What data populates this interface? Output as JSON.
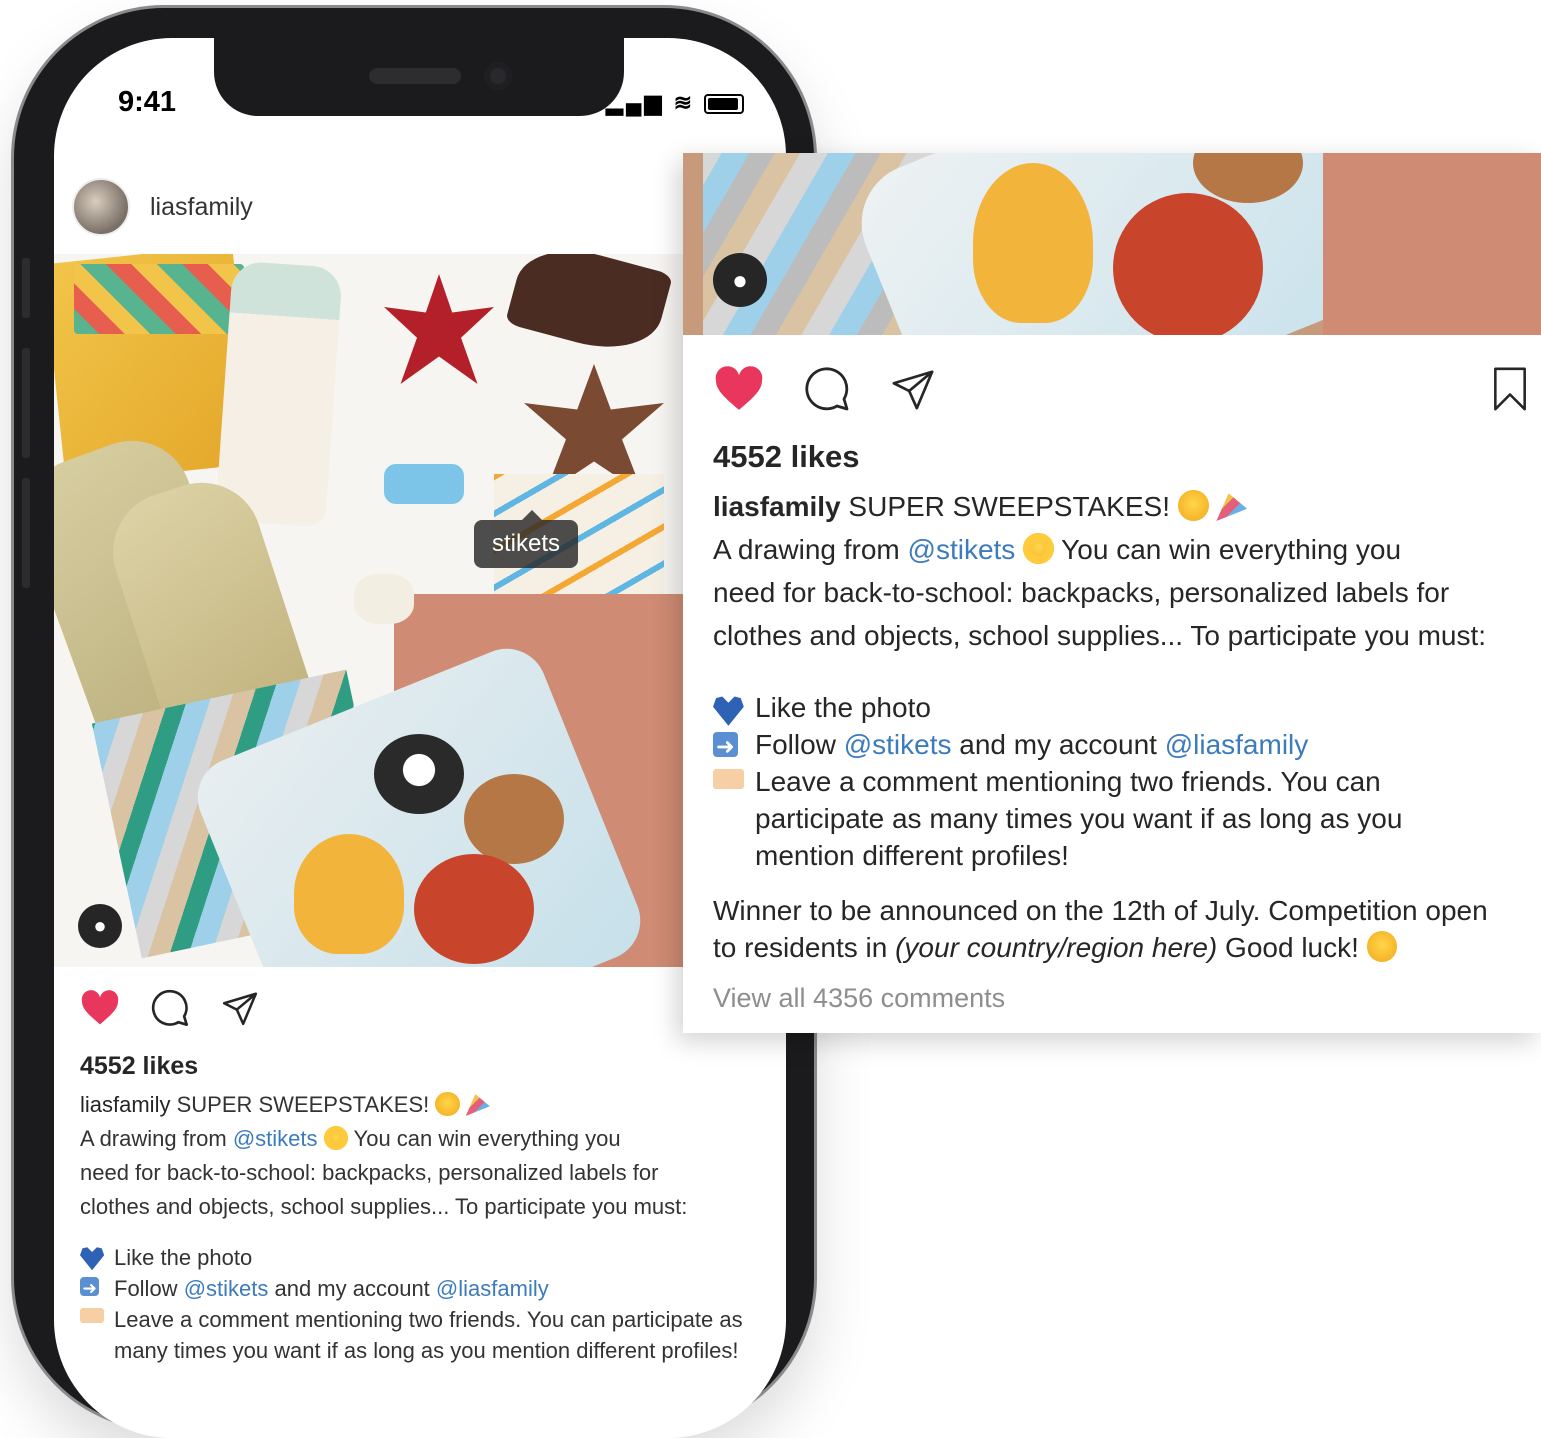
{
  "status_bar": {
    "time": "9:41"
  },
  "post": {
    "username": "liasfamily",
    "photo_tag": "stikets",
    "likes": "4552 likes",
    "caption": {
      "username": "liasfamily",
      "headline": "SUPER SWEEPSTAKES!",
      "intro_pre": "A drawing from ",
      "intro_mention": "@stikets",
      "line1_post": " You can win everything you",
      "line2": "need for back-to-school: backpacks, personalized labels for",
      "line3": "clothes and objects, school supplies... To participate you must:",
      "bullet_like": "Like the photo",
      "bullet_follow_pre": "Follow ",
      "bullet_follow_mention1": "@stikets",
      "bullet_follow_mid": " and my account ",
      "bullet_follow_mention2": "@liasfamily",
      "bullet_comment": "Leave a comment mentioning two friends. You can participate as many times you want if as long as you mention different profiles!",
      "winner_pre": "Winner to be announced on the 12th of July. Competition open to residents in ",
      "winner_region": "(your country/region here)",
      "winner_post": " Good luck!"
    },
    "view_all": "View all 4356 comments"
  },
  "icons": {
    "like": "heart-filled-icon",
    "comment": "comment-bubble-icon",
    "share": "paper-plane-icon",
    "save": "bookmark-icon",
    "user_tag": "person-icon"
  },
  "colors": {
    "like_red": "#e8365d",
    "mention_blue": "#3c7bbd",
    "muted_gray": "#8e8e8e"
  }
}
